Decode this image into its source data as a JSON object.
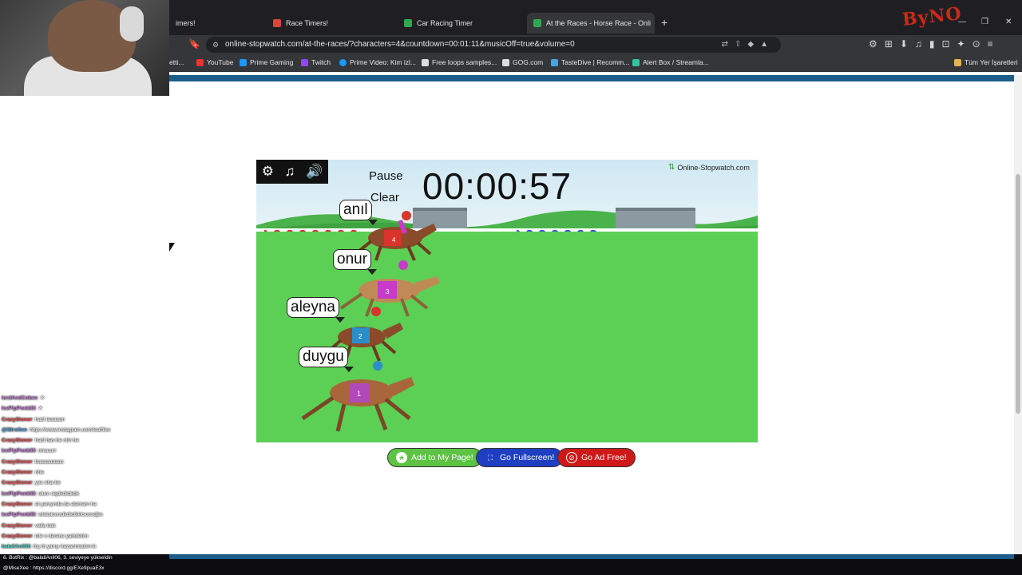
{
  "browser": {
    "tabs": [
      {
        "label": "imers!",
        "favicon_color": "#3a7bd5"
      },
      {
        "label": "Race Timers!",
        "favicon_color": "#d8463a"
      },
      {
        "label": "Car Racing Timer",
        "favicon_color": "#2fa84f"
      },
      {
        "label": "At the Races - Horse Race - Onli",
        "favicon_color": "#2fa84f",
        "active": true
      }
    ],
    "new_tab_label": "+",
    "url": "online-stopwatch.com/at-the-races/?characters=4&countdown=00:01:11&musicOff=true&volume=0",
    "bookmarks": [
      {
        "label": "etti...",
        "color": "#888888"
      },
      {
        "label": "YouTube",
        "color": "#e33"
      },
      {
        "label": "Prime Gaming",
        "color": "#1a98ff"
      },
      {
        "label": "Twitch",
        "color": "#9146ff"
      },
      {
        "label": "Prime Video: Kim izl...",
        "color": "#1a98ff"
      },
      {
        "label": "Free loops samples...",
        "color": "#dddddd"
      },
      {
        "label": "GOG.com",
        "color": "#dddddd"
      },
      {
        "label": "TasteDive | Recomm...",
        "color": "#4aa3df"
      },
      {
        "label": "Alert Box / Streamla...",
        "color": "#31c3a2"
      },
      {
        "label": "Tüm Yer İşaretleri",
        "color": "#e6b24a"
      }
    ],
    "brand_overlay": "ByNO"
  },
  "game": {
    "pause_label": "Pause",
    "clear_label": "Clear",
    "timer": "00:00:57",
    "brand": "Online-Stopwatch.com",
    "racers": [
      {
        "name": "anıl",
        "number": "4",
        "silk": "#d9342b"
      },
      {
        "name": "onur",
        "number": "3",
        "silk": "#c93ac8"
      },
      {
        "name": "aleyna",
        "number": "2",
        "silk": "#2a8fc8"
      },
      {
        "name": "duygu",
        "number": "1",
        "silk": "#b14ab8"
      }
    ],
    "buttons": {
      "add": "Add to My Page!",
      "fullscreen": "Go Fullscreen!",
      "adfree": "Go Ad Free!"
    }
  },
  "chat": [
    {
      "user": "lordAndCobee",
      "msg": ": ✕",
      "color": "#c77dd6"
    },
    {
      "user": "IcePipPonkIIII",
      "msg": ": ✕",
      "color": "#c77dd6"
    },
    {
      "user": "CrazyStoner",
      "msg": ": hadi iaaaaan",
      "color": "#e94f4f"
    },
    {
      "user": "@MiroXee",
      "msg": ": https://www.instagram.com/leafflixx",
      "color": "#4aa3df"
    },
    {
      "user": "CrazyStoner",
      "msg": ": hadi bas be olm be",
      "color": "#e94f4f"
    },
    {
      "user": "IcePipPonkIIII",
      "msg": ": onuuurr",
      "color": "#c77dd6"
    },
    {
      "user": "CrazyStoner",
      "msg": ": baaaaaaaas",
      "color": "#e94f4f"
    },
    {
      "user": "CrazyStoner",
      "msg": ": oha",
      "color": "#e94f4f"
    },
    {
      "user": "CrazyStoner",
      "msg": ": yav oha be",
      "color": "#e94f4f"
    },
    {
      "user": "IcePipPonkIIII",
      "msg": ": olum skjdkdkdkdk",
      "color": "#c77dd6"
    },
    {
      "user": "CrazyStoner",
      "msg": ": at yarışında da alamam ha",
      "color": "#e94f4f"
    },
    {
      "user": "IcePipPonkIIII",
      "msg": ": wlsksksxxdkdkdkkksossdjks",
      "color": "#c77dd6"
    },
    {
      "user": "CrazyStoner",
      "msg": ": valla bak",
      "color": "#e94f4f"
    },
    {
      "user": "CrazyStoner",
      "msg": ": izle o derece yaduletim",
      "color": "#e94f4f"
    },
    {
      "user": "balallAnll06",
      "msg": ": hiç bi yarışı kazanmadım ki",
      "color": "#4fd3c4"
    }
  ],
  "bottom": {
    "line1": "6. BotRix : @balallAnll06, 3. seviyeye yükseldin",
    "line2": "@MiseXee : https://discord.gg/EXe9puaE3x"
  }
}
